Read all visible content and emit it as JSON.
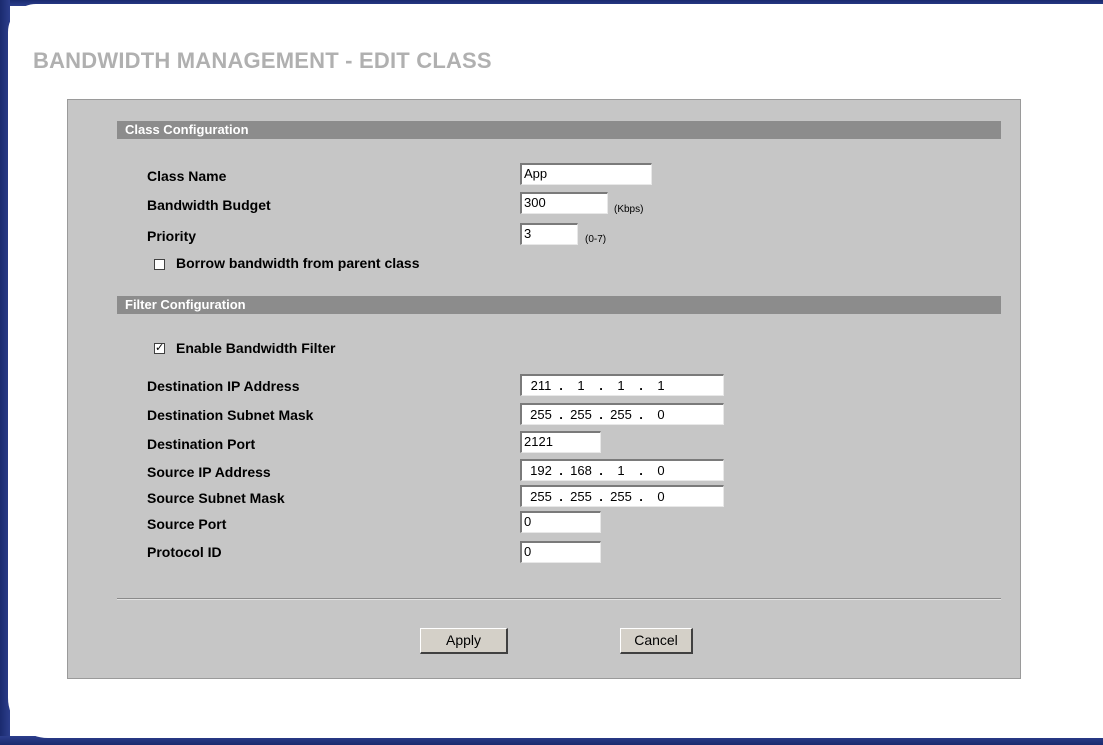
{
  "page": {
    "title": "BANDWIDTH MANAGEMENT - EDIT CLASS"
  },
  "class_config": {
    "header": "Class Configuration",
    "class_name_label": "Class Name",
    "class_name_value": "App",
    "budget_label": "Bandwidth Budget",
    "budget_value": "300",
    "budget_unit": "(Kbps)",
    "priority_label": "Priority",
    "priority_value": "3",
    "priority_range": "(0-7)",
    "borrow_label": "Borrow bandwidth from parent class",
    "borrow_checked": false
  },
  "filter_config": {
    "header": "Filter Configuration",
    "enable_label": "Enable Bandwidth Filter",
    "enable_checked": true,
    "dest_ip_label": "Destination IP Address",
    "dest_ip": [
      "211",
      "1",
      "1",
      "1"
    ],
    "dest_mask_label": "Destination Subnet Mask",
    "dest_mask": [
      "255",
      "255",
      "255",
      "0"
    ],
    "dest_port_label": "Destination Port",
    "dest_port_value": "2121",
    "src_ip_label": "Source IP Address",
    "src_ip": [
      "192",
      "168",
      "1",
      "0"
    ],
    "src_mask_label": "Source Subnet Mask",
    "src_mask": [
      "255",
      "255",
      "255",
      "0"
    ],
    "src_port_label": "Source Port",
    "src_port_value": "0",
    "protocol_label": "Protocol ID",
    "protocol_value": "0"
  },
  "buttons": {
    "apply": "Apply",
    "cancel": "Cancel"
  },
  "colors": {
    "frame": "#2c3e8c",
    "panel": "#c6c6c6",
    "section_bar": "#8c8c8c",
    "title": "#b0b0b0"
  }
}
